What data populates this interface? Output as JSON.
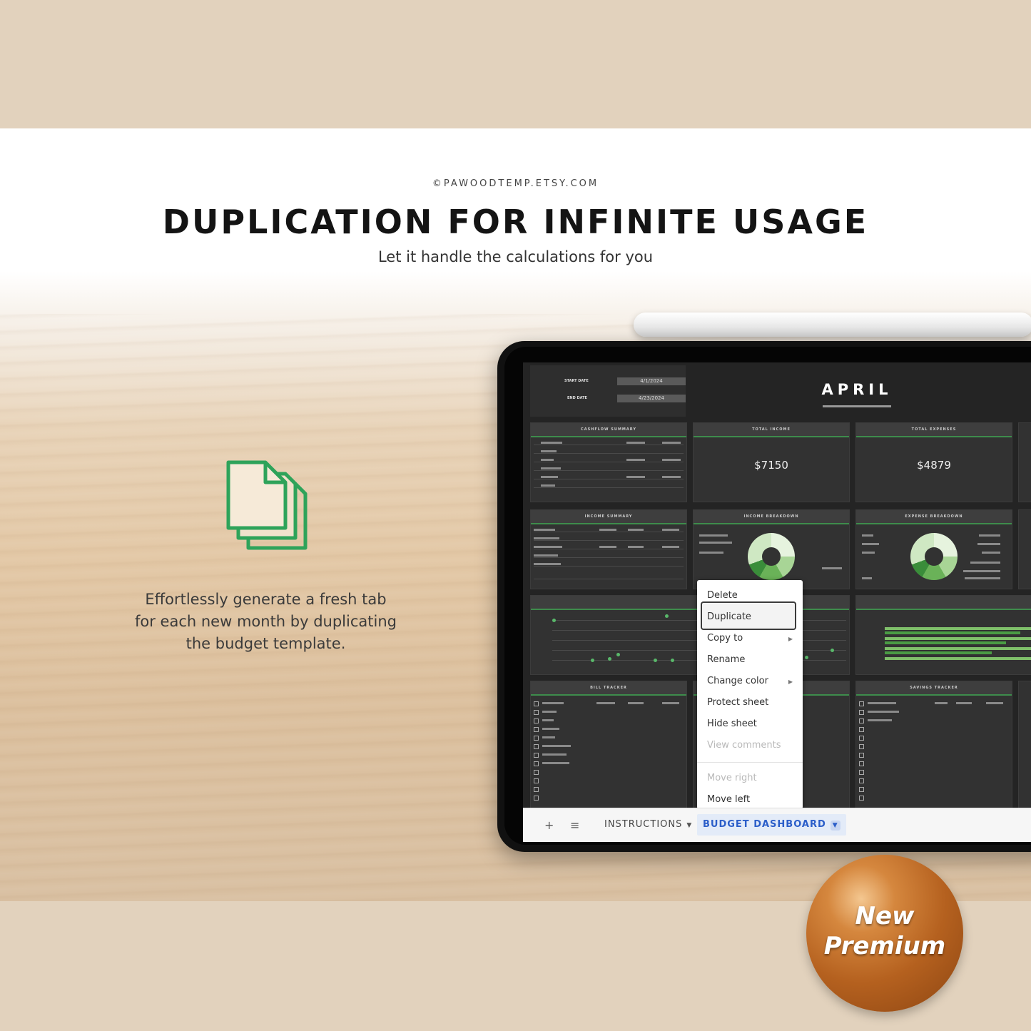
{
  "header": {
    "site": "©PAWOODTEMP.ETSY.COM",
    "title": "DUPLICATION FOR INFINITE USAGE",
    "subtitle": "Let it handle the calculations for you"
  },
  "description": {
    "lines": [
      "Effortlessly generate a fresh tab",
      "for each new month by duplicating",
      "the budget template."
    ]
  },
  "icons": {
    "documents": "duplicate-documents-icon",
    "accent": "#2ea35a"
  },
  "sheet": {
    "start_date_label": "START DATE",
    "end_date_label": "END DATE",
    "start_date": "4/1/2024",
    "end_date": "4/23/2024",
    "month": "APRIL",
    "panels": {
      "cashflow": "CASHFLOW SUMMARY",
      "total_income": "TOTAL INCOME",
      "total_expenses": "TOTAL EXPENSES",
      "income_summary": "INCOME SUMMARY",
      "income_breakdown": "INCOME BREAKDOWN",
      "expense_breakdown": "EXPENSE BREAKDOWN",
      "bill_tracker": "BILL TRACKER",
      "savings_tracker": "SAVINGS TRACKER"
    },
    "total_income_value": "$7150",
    "total_expenses_value": "$4879"
  },
  "tabbar": {
    "add": "+",
    "menu": "≡",
    "tabs": [
      {
        "label": "INSTRUCTIONS",
        "active": false
      },
      {
        "label": "BUDGET DASHBOARD",
        "active": true
      }
    ]
  },
  "context_menu": {
    "items": [
      {
        "label": "Delete",
        "enabled": true
      },
      {
        "label": "Duplicate",
        "enabled": true,
        "highlighted": true
      },
      {
        "label": "Copy to",
        "enabled": true,
        "submenu": true
      },
      {
        "label": "Rename",
        "enabled": true
      },
      {
        "label": "Change color",
        "enabled": true,
        "submenu": true
      },
      {
        "label": "Protect sheet",
        "enabled": true
      },
      {
        "label": "Hide sheet",
        "enabled": true
      },
      {
        "label": "View comments",
        "enabled": false
      },
      {
        "label": "Move right",
        "enabled": false
      },
      {
        "label": "Move left",
        "enabled": true
      }
    ]
  },
  "badge": {
    "line1": "New",
    "line2": "Premium",
    "color": "#b5611f"
  }
}
